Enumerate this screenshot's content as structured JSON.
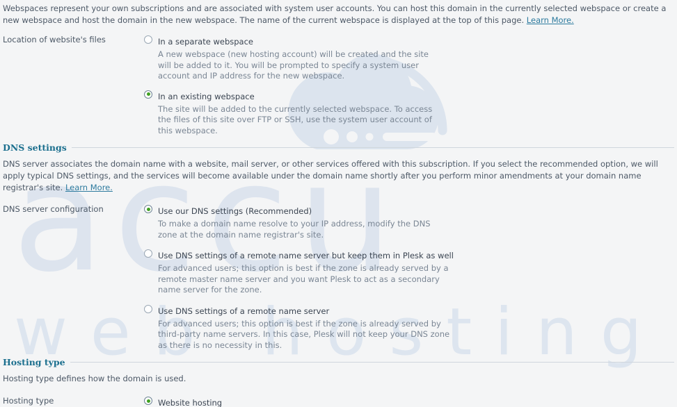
{
  "page": {
    "intro": {
      "text": "Webspaces represent your own subscriptions and are associated with system user accounts. You can host this domain in the currently selected webspace or create a new webspace and host the domain in the new webspace. The name of the current webspace is displayed at the top of this page. ",
      "link_label": "Learn More."
    },
    "watermark": {
      "brand_mark": "accu",
      "brand_tagline": "web hosting",
      "logo_icon": "cloud-wifi-logo"
    }
  },
  "webspace_location": {
    "row_label": "Location of website's files",
    "options": [
      {
        "label": "In a separate webspace",
        "checked": false,
        "description": "A new webspace (new hosting account) will be created and the site will be added to it. You will be prompted to specify a system user account and IP address for the new webspace."
      },
      {
        "label": "In an existing webspace",
        "checked": true,
        "description": "The site will be added to the currently selected webspace. To access the files of this site over FTP or SSH, use the system user account of this webspace."
      }
    ]
  },
  "dns_settings": {
    "section_title": "DNS settings",
    "description": {
      "text": "DNS server associates the domain name with a website, mail server, or other services offered with this subscription. If you select the recommended option, we will apply typical DNS settings, and the services will become available under the domain name shortly after you perform minor amendments at your domain name registrar's site. ",
      "link_label": "Learn More."
    },
    "row_label": "DNS server configuration",
    "options": [
      {
        "label": "Use our DNS settings (Recommended)",
        "checked": true,
        "description": "To make a domain name resolve to your IP address, modify the DNS zone at the domain name registrar's site."
      },
      {
        "label": "Use DNS settings of a remote name server but keep them in Plesk as well",
        "checked": false,
        "description": "For advanced users; this option is best if the zone is already served by a remote master name server and you want Plesk to act as a secondary name server for the zone."
      },
      {
        "label": "Use DNS settings of a remote name server",
        "checked": false,
        "description": "For advanced users; this option is best if the zone is already served by third-party name servers. In this case, Plesk will not keep your DNS zone as there is no necessity in this."
      }
    ]
  },
  "hosting_type": {
    "section_title": "Hosting type",
    "description": "Hosting type defines how the domain is used.",
    "row_label": "Hosting type",
    "options": [
      {
        "label": "Website hosting",
        "checked": true,
        "description": ""
      }
    ]
  },
  "colors": {
    "page_background": "#f4f5f6",
    "body_text": "#4c5866",
    "muted_text": "#7a8694",
    "section_title": "#1b6f8e",
    "link": "#2c7a9e",
    "radio_selected_dot": "#3fa021",
    "watermark": "#dce4ee",
    "divider": "#cfd6dd"
  }
}
